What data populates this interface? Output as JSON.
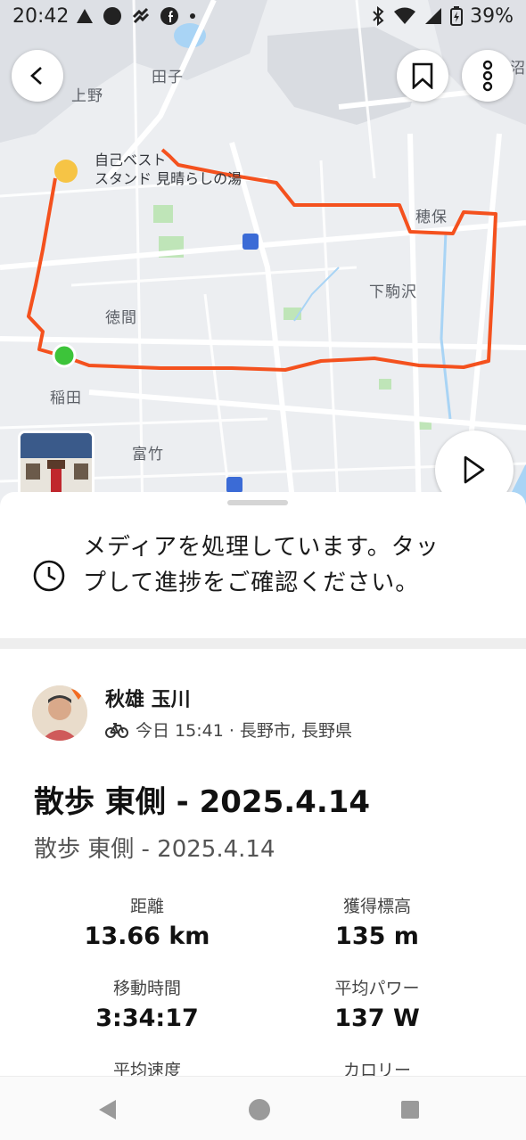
{
  "status_bar": {
    "time": "20:42",
    "battery_percent": "39%"
  },
  "map": {
    "labels": {
      "tago": "田子",
      "ueno": "上野",
      "poi_line1": "自己ベスト",
      "poi_line2": "スタンド 見晴らしの湯",
      "hobo": "穂保",
      "shimokomazawa": "下駒沢",
      "tokuma": "徳間",
      "inada": "稲田",
      "tomitake": "富竹",
      "edge": "沼"
    },
    "route_color": "#f4511e",
    "start_marker_color": "#3dc43a",
    "poi_icon_label": "PR"
  },
  "media_notice": {
    "text": "メディアを処理しています。タップして進捗をご確認ください。"
  },
  "athlete": {
    "name": "秋雄 玉川",
    "meta": "今日 15:41 · 長野市, 長野県"
  },
  "activity": {
    "title": "散歩 東側 - 2025.4.14",
    "subtitle": "散歩 東側 - 2025.4.14"
  },
  "stats": [
    {
      "label": "距離",
      "value": "13.66 km"
    },
    {
      "label": "獲得標高",
      "value": "135 m"
    },
    {
      "label": "移動時間",
      "value": "3:34:17"
    },
    {
      "label": "平均パワー",
      "value": "137 W"
    },
    {
      "label": "平均速度",
      "value": ""
    },
    {
      "label": "カロリー",
      "value": ""
    }
  ],
  "colors": {
    "accent": "#fc4c02"
  },
  "icons": {
    "back": "back-arrow-icon",
    "bookmark": "bookmark-icon",
    "more": "more-vertical-icon",
    "play": "play-icon",
    "clock": "clock-icon",
    "bike": "bicycle-icon"
  }
}
